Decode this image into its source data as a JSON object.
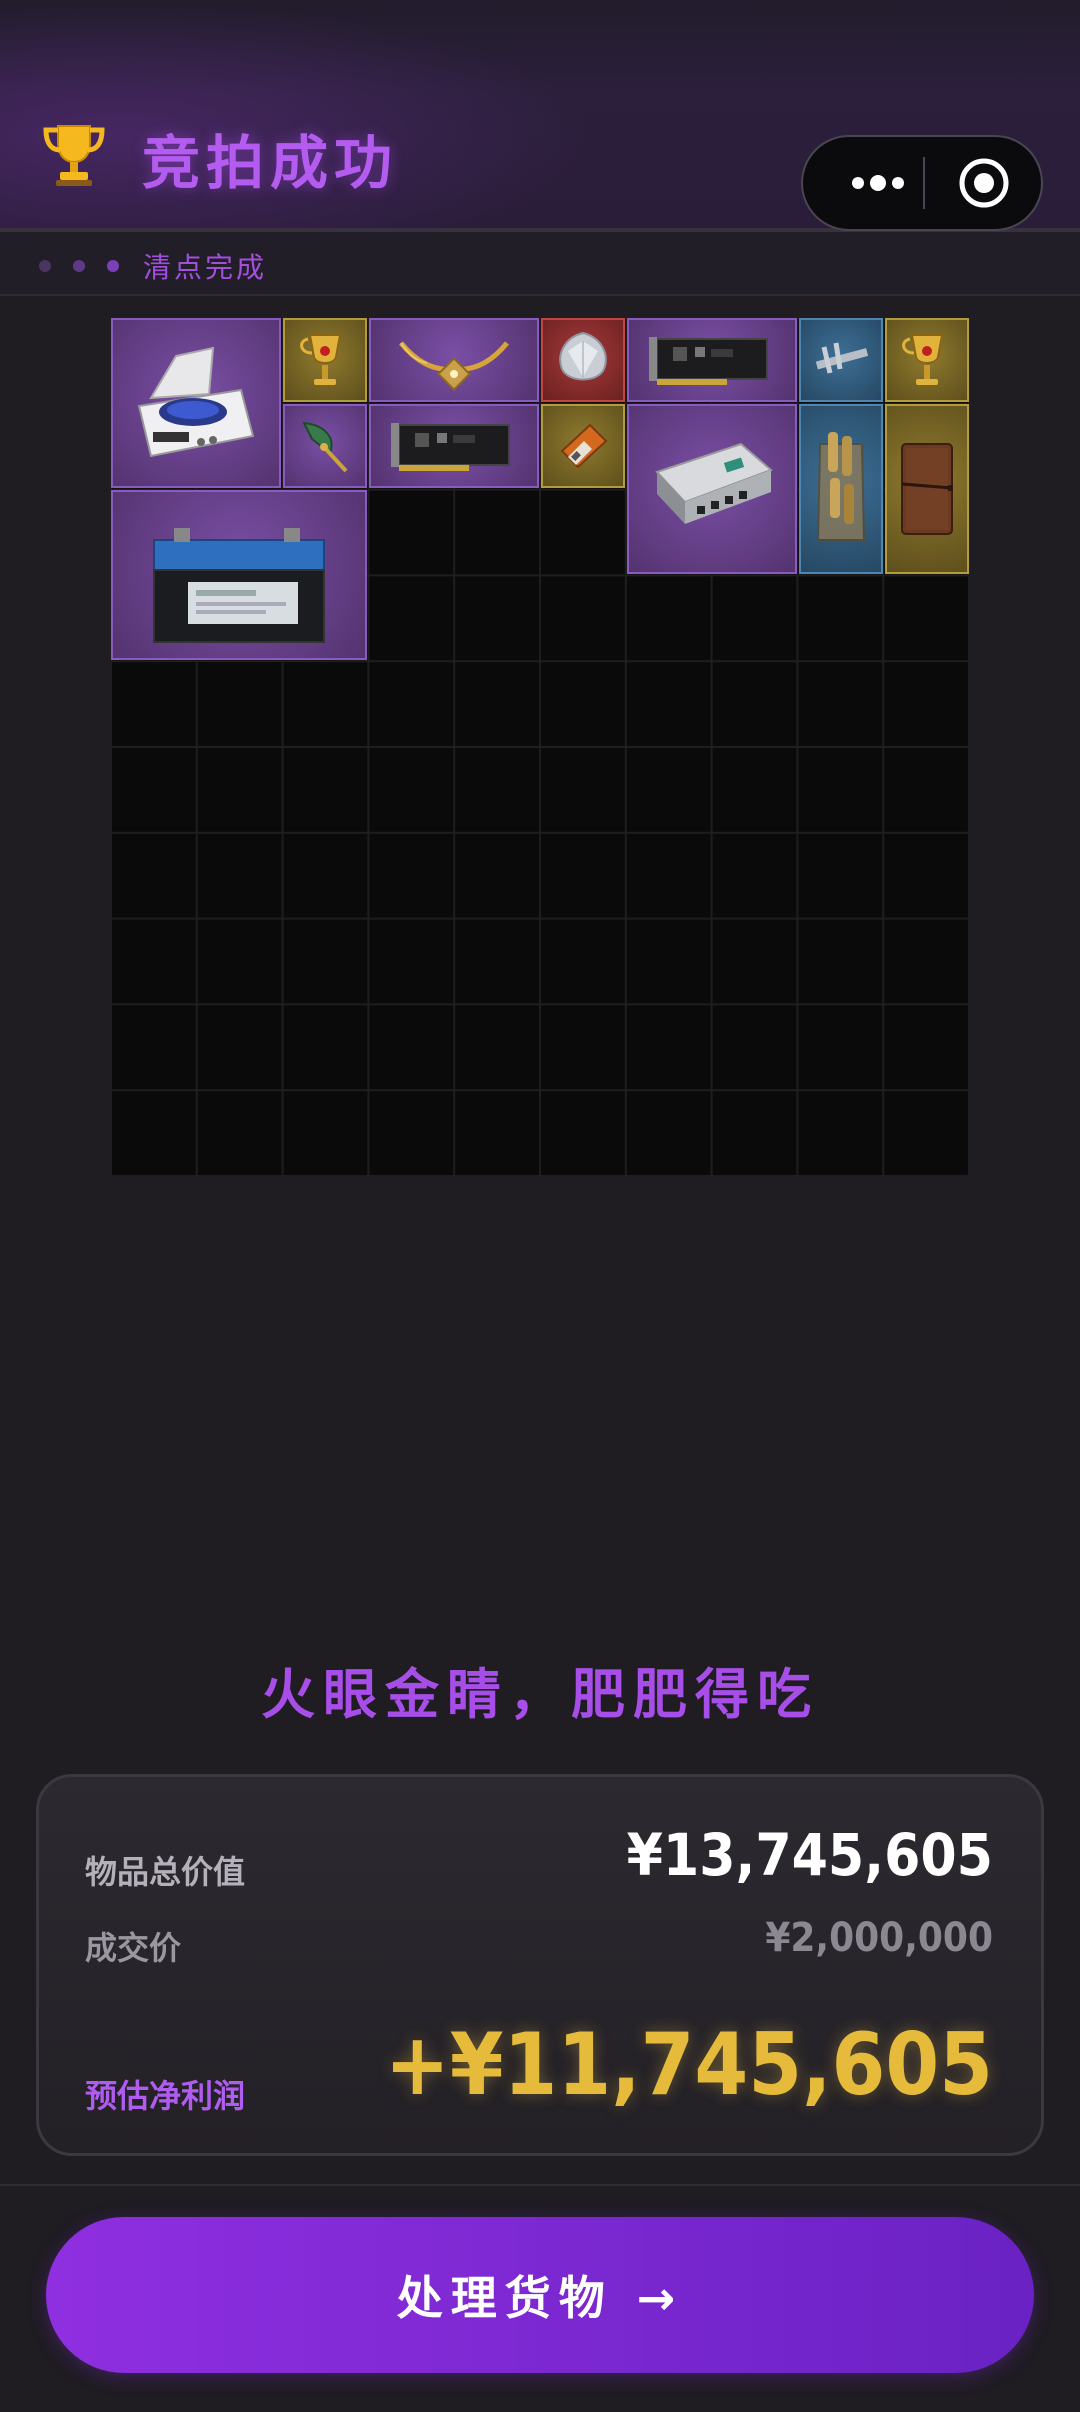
{
  "header": {
    "title": "竞拍成功",
    "trophy_icon": "trophy-icon"
  },
  "capsule": {
    "more_icon": "more-dots-icon",
    "target_icon": "target-icon"
  },
  "subbar": {
    "status": "清点完成",
    "dot_colors": [
      "#4a3560",
      "#5e3a86",
      "#7b3fb8"
    ]
  },
  "inventory": {
    "rarity_colors": {
      "purple": "#8a5bbf",
      "gold": "#b29c3c",
      "red": "#c24444",
      "blue": "#4e86b1"
    },
    "items": [
      {
        "name": "centrifuge",
        "rarity": "purple"
      },
      {
        "name": "golden-chalice",
        "rarity": "gold"
      },
      {
        "name": "horned-necklace",
        "rarity": "purple"
      },
      {
        "name": "diamond",
        "rarity": "red"
      },
      {
        "name": "graphics-card",
        "rarity": "purple"
      },
      {
        "name": "caliper",
        "rarity": "blue"
      },
      {
        "name": "golden-chalice",
        "rarity": "gold"
      },
      {
        "name": "spearhead-pendant",
        "rarity": "purple"
      },
      {
        "name": "graphics-card",
        "rarity": "purple"
      },
      {
        "name": "ration-bar",
        "rarity": "gold"
      },
      {
        "name": "network-router",
        "rarity": "purple"
      },
      {
        "name": "ammo-bag",
        "rarity": "blue"
      },
      {
        "name": "leather-journal",
        "rarity": "gold"
      },
      {
        "name": "car-battery",
        "rarity": "purple"
      }
    ]
  },
  "slogan": "火眼金睛，肥肥得吃",
  "summary": {
    "total_label": "物品总价值",
    "total_value": "¥13,745,605",
    "deal_label": "成交价",
    "deal_value": "¥2,000,000",
    "profit_label": "预估净利润",
    "profit_value": "+¥11,745,605",
    "profit_color": "#e6bb3c",
    "label_purple": "#b05cf0"
  },
  "cta": {
    "label": "处理货物 →"
  }
}
